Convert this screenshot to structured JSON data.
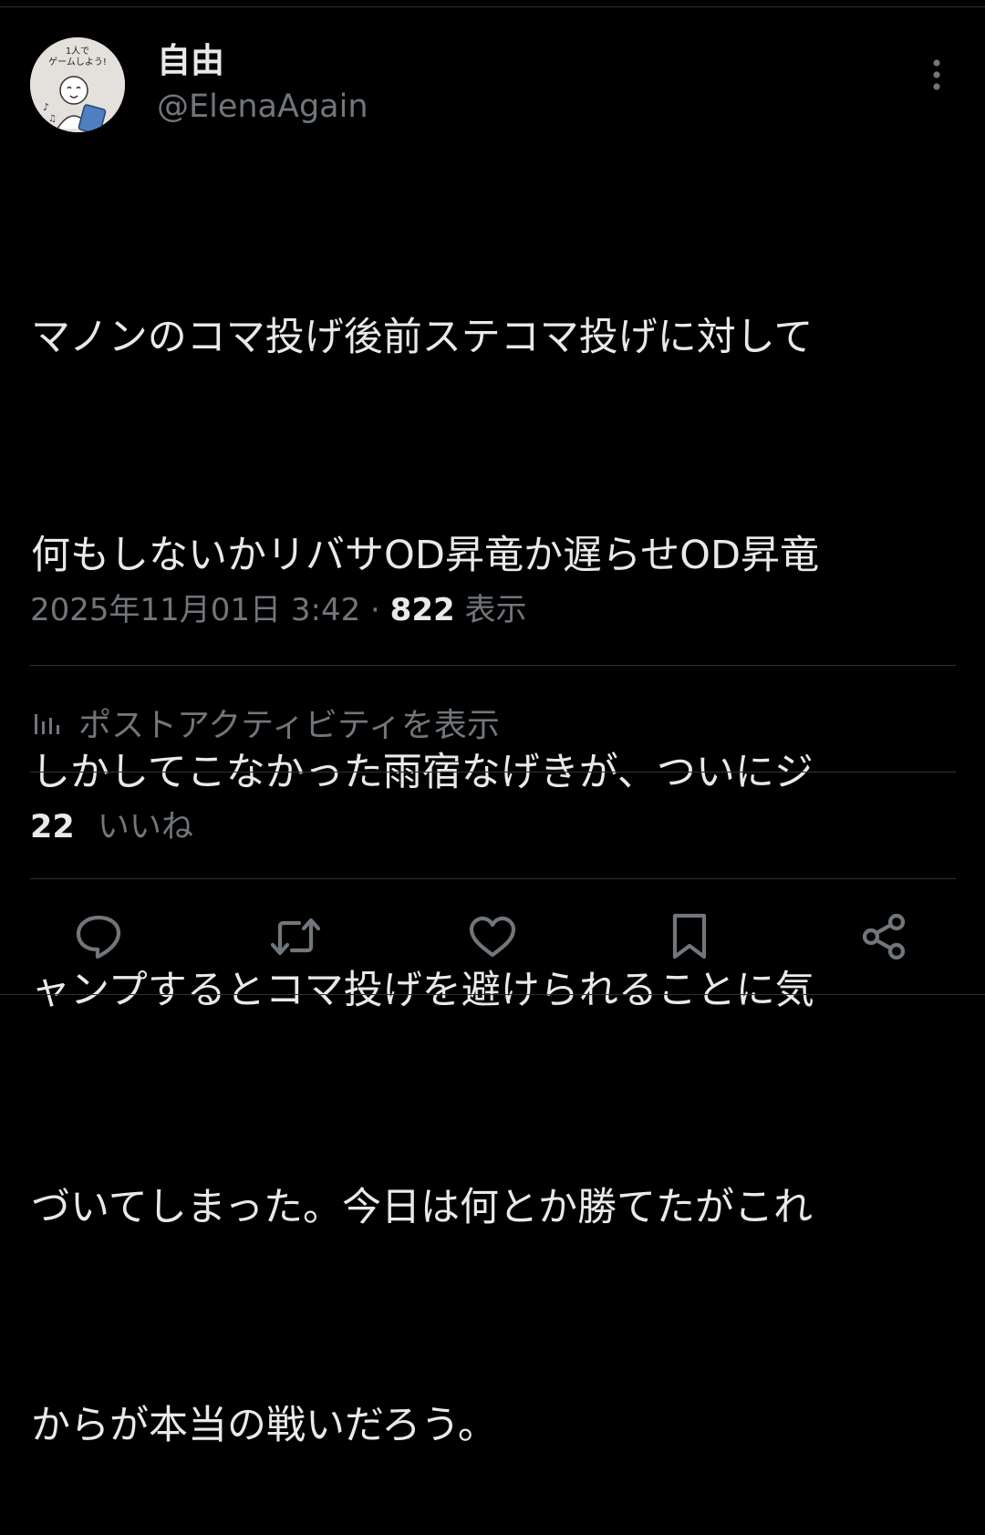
{
  "author": {
    "display_name": "自由",
    "handle": "@ElenaAgain",
    "avatar_caption": "1人でゲームしよう!"
  },
  "tweet": {
    "lines": [
      "マノンのコマ投げ後前ステコマ投げに対して",
      "何もしないかリバサOD昇竜か遅らせOD昇竜",
      "しかしてこなかった雨宿なげきが、ついにジ",
      "ャンプするとコマ投げを避けられることに気",
      "づいてしまった。今日は何とか勝てたがこれ",
      "からが本当の戦いだろう。"
    ]
  },
  "meta": {
    "timestamp": "2025年11月01日 3:42",
    "dot": "·",
    "views_count": "822",
    "views_label": "表示"
  },
  "activity": {
    "label": "ポストアクティビティを表示",
    "icon": "bar-chart-icon"
  },
  "likes": {
    "count": "22",
    "label": "いいね"
  },
  "actions": [
    {
      "icon": "reply-icon"
    },
    {
      "icon": "repost-icon"
    },
    {
      "icon": "like-icon"
    },
    {
      "icon": "bookmark-icon"
    },
    {
      "icon": "share-icon"
    }
  ],
  "colors": {
    "background": "#000000",
    "primary_text": "#e7e9ea",
    "secondary_text": "#71767b",
    "divider": "#2f3336"
  }
}
